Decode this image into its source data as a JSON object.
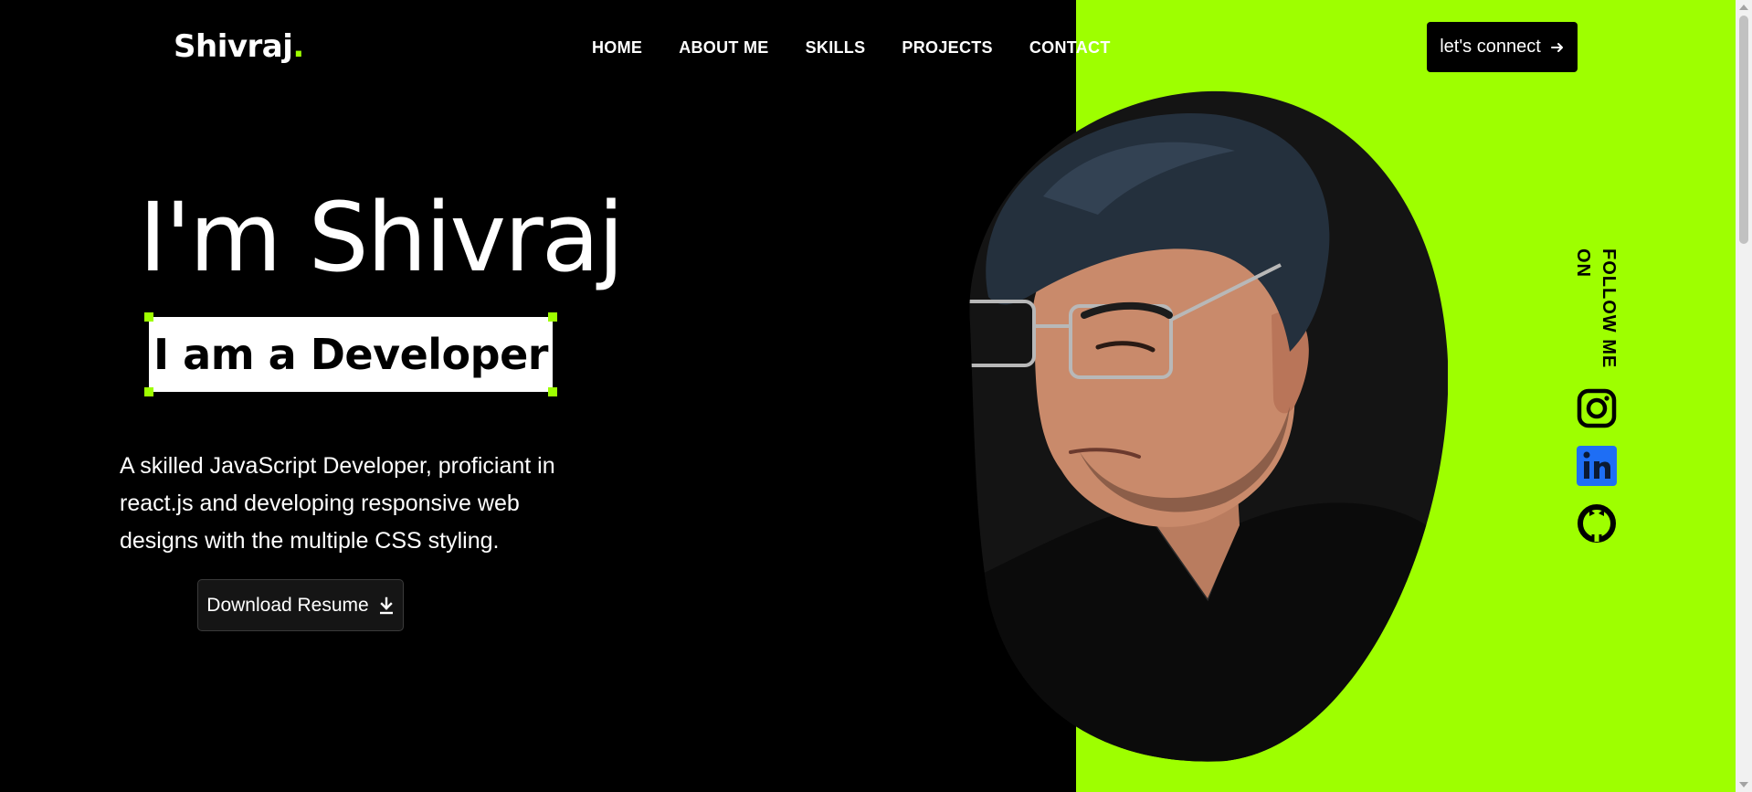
{
  "brand": {
    "name": "Shivraj",
    "dot": ".",
    "accent_color": "#9eff00"
  },
  "nav": {
    "items": [
      {
        "label": "HOME"
      },
      {
        "label": "ABOUT ME"
      },
      {
        "label": "SKILLS"
      },
      {
        "label": "PROJECTS"
      },
      {
        "label": "CONTACT"
      }
    ]
  },
  "header": {
    "connect_label": "let's connect",
    "connect_icon": "arrow-right-icon"
  },
  "hero": {
    "title": "I'm Shivraj",
    "role": "I am a Developer",
    "description": "A skilled JavaScript Developer, proficiant in react.js and developing responsive web designs with the multiple CSS styling.",
    "download_label": "Download Resume",
    "download_icon": "download-icon"
  },
  "follow": {
    "label": "FOLLOW ME ON",
    "icons": [
      "instagram-icon",
      "linkedin-icon",
      "github-icon"
    ],
    "linkedin_color": "#1e6ef5"
  },
  "colors": {
    "background": "#000000",
    "panel": "#9eff00",
    "text": "#ffffff"
  }
}
